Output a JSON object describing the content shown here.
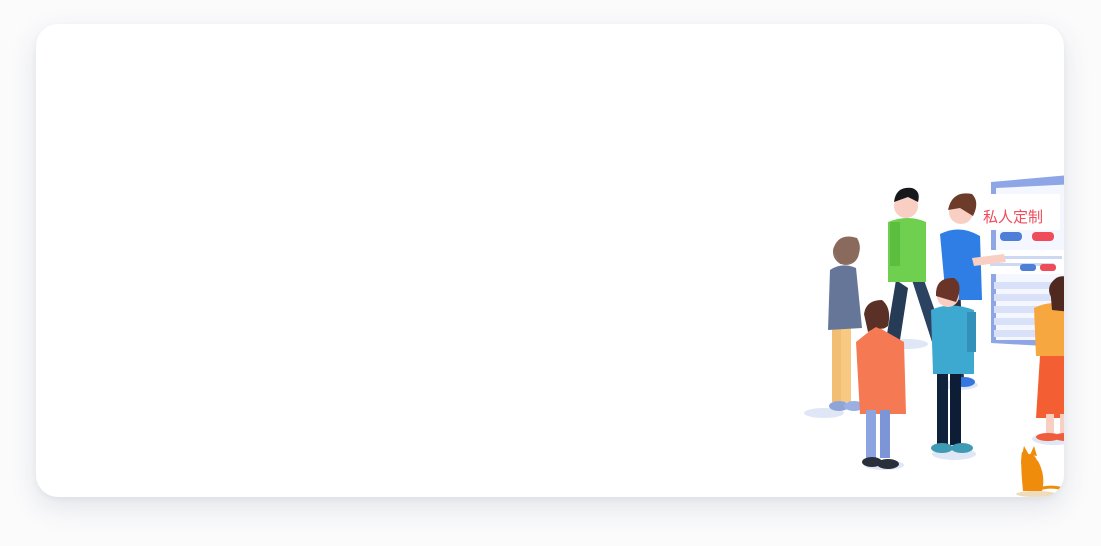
{
  "illustration": {
    "board_title": "私人定制",
    "colors": {
      "board": "#8ea6e6",
      "board_light": "#dfe7f9",
      "accent_red": "#ef4b5b",
      "accent_blue": "#4d7ed8",
      "shadow": "#dfe6f6"
    },
    "icons": [
      "team-illustration",
      "cat-icon"
    ]
  }
}
